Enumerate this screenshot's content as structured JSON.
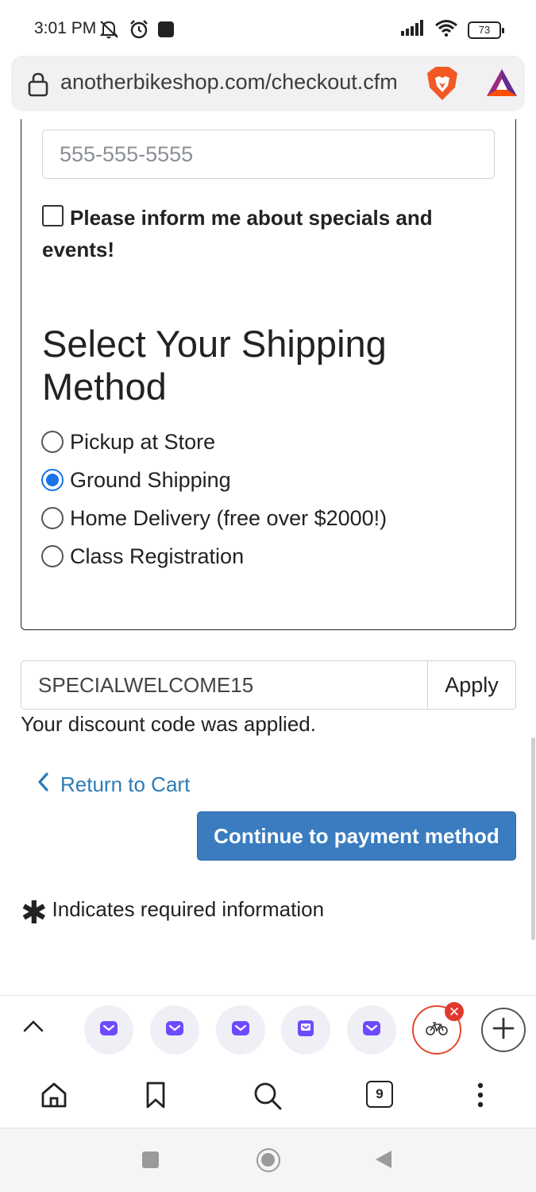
{
  "status_bar": {
    "time": "3:01 PM",
    "battery": "73",
    "icons": [
      "mute-notifications-icon",
      "alarm-icon",
      "app-notification-icon",
      "signal-icon",
      "wifi-icon",
      "battery-icon"
    ]
  },
  "browser": {
    "url": "anotherbikeshop.com/checkout.cfm",
    "icons": [
      "lock-icon",
      "brave-shields-icon",
      "brave-rewards-icon"
    ]
  },
  "form": {
    "phone_placeholder": "555-555-5555",
    "optin_label": "Please inform me about specials and events!",
    "shipping_heading": "Select Your Shipping Method",
    "shipping_options": [
      {
        "label": "Pickup at Store",
        "selected": false
      },
      {
        "label": "Ground Shipping",
        "selected": true
      },
      {
        "label": "Home Delivery (free over $2000!)",
        "selected": false
      },
      {
        "label": "Class Registration",
        "selected": false
      }
    ]
  },
  "discount": {
    "code_value": "SPECIALWELCOME15",
    "apply_label": "Apply",
    "message": "Your discount code was applied."
  },
  "actions": {
    "return_label": "Return to Cart",
    "continue_label": "Continue to payment method",
    "required_note": "Indicates required information",
    "required_symbol": "✱"
  },
  "tabs": {
    "count": "9",
    "close_symbol": "✕",
    "items": [
      "tab-proton-1",
      "tab-proton-2",
      "tab-proton-3",
      "tab-proton-4",
      "tab-proton-5",
      "tab-bike-active"
    ]
  },
  "colors": {
    "accent": "#3a7cbf",
    "link": "#2d7bb6",
    "radio_checked": "#1a73e8",
    "tab_active_ring": "#e24a2a",
    "proton_purple": "#6d4aff"
  }
}
